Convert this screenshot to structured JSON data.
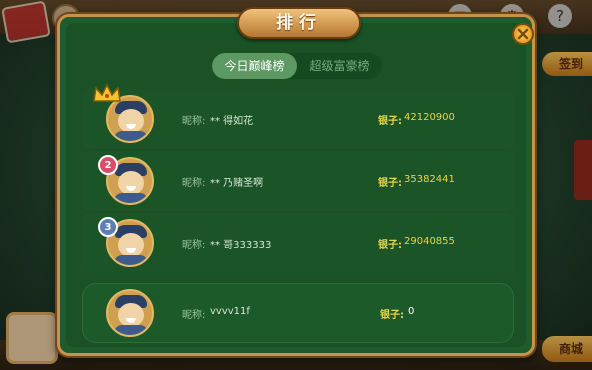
{
  "modal": {
    "title": "排行"
  },
  "tabs": [
    {
      "label": "今日巅峰榜",
      "active": true
    },
    {
      "label": "超级富豪榜",
      "active": false
    }
  ],
  "labels": {
    "nickname": "昵称:",
    "silver": "银子:"
  },
  "ranking": [
    {
      "rank": 1,
      "badge": "crown-icon",
      "nickname": "** 得如花",
      "silver": "42120900"
    },
    {
      "rank": 2,
      "badge": "2",
      "nickname": "** 乃赌圣啊",
      "silver": "35382441"
    },
    {
      "rank": 3,
      "badge": "3",
      "nickname": "** 哥333333",
      "silver": "29040855"
    }
  ],
  "self_row": {
    "nickname": "vvvv11f",
    "silver": "0"
  },
  "background": {
    "side_buttons": [
      "签到",
      "商城"
    ],
    "icons": [
      "mail-icon",
      "settings-icon",
      "help-icon"
    ]
  },
  "colors": {
    "modal_bg": "#1f5b2c",
    "border_gold": "#c7934c",
    "silver_text": "#e8d44e",
    "tab_active": "#5d9a63",
    "badge_rank2": "#d94c6a",
    "badge_rank3": "#5b7fb5"
  }
}
